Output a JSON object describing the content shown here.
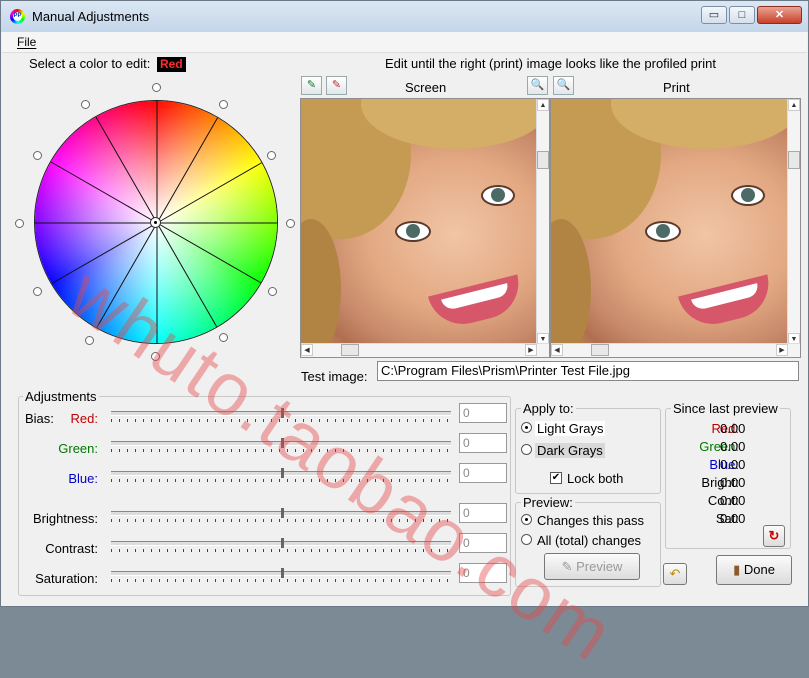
{
  "window": {
    "title": "Manual Adjustments",
    "app_icon": "pp-app-icon"
  },
  "window_controls": {
    "minimize": "▭",
    "maximize": "□",
    "close": "✕"
  },
  "menu": {
    "file": "File"
  },
  "color_select": {
    "label": "Select a color to edit:",
    "selected": "Red"
  },
  "edit_hint": "Edit until the right (print) image looks like the profiled print",
  "panes": {
    "screen": "Screen",
    "print": "Print"
  },
  "test_image": {
    "label": "Test image:",
    "path": "C:\\Program Files\\Prism\\Printer Test File.jpg"
  },
  "adjustments": {
    "title": "Adjustments",
    "bias_label": "Bias:",
    "sliders": [
      {
        "label": "Red:",
        "value": "0",
        "color": "#c00000"
      },
      {
        "label": "Green:",
        "value": "0",
        "color": "#007800"
      },
      {
        "label": "Blue:",
        "value": "0",
        "color": "#0000c8"
      },
      {
        "label": "Brightness:",
        "value": "0",
        "color": "#000000"
      },
      {
        "label": "Contrast:",
        "value": "0",
        "color": "#000000"
      },
      {
        "label": "Saturation:",
        "value": "0",
        "color": "#000000"
      }
    ]
  },
  "apply_to": {
    "title": "Apply to:",
    "light_grays": "Light Grays",
    "dark_grays": "Dark Grays",
    "lock_both": "Lock both",
    "selected": "light_grays",
    "lock_checked": true
  },
  "preview": {
    "title": "Preview:",
    "changes_this_pass": "Changes this pass",
    "all_changes": "All (total) changes",
    "selected": "changes_this_pass",
    "button": "Preview"
  },
  "since_last_preview": {
    "title": "Since last preview",
    "rows": [
      {
        "label": "Red:",
        "value": "0.00",
        "color": "#c00000"
      },
      {
        "label": "Green:",
        "value": "0.00",
        "color": "#007800"
      },
      {
        "label": "Blue:",
        "value": "0.00",
        "color": "#0000c8"
      },
      {
        "label": "Bright:",
        "value": "0.00",
        "color": "#000000"
      },
      {
        "label": "Cont:",
        "value": "0.00",
        "color": "#000000"
      },
      {
        "label": "Sat:",
        "value": "0.00",
        "color": "#000000"
      }
    ]
  },
  "buttons": {
    "done": "Done"
  },
  "watermark": "whuto.taobao.com"
}
